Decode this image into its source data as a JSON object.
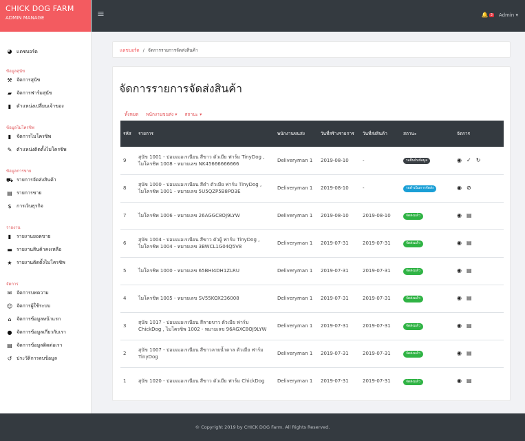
{
  "brand": {
    "title": "CHICK DOG FARM",
    "subtitle": "ADMIN MANAGE",
    "color": "#f35b60"
  },
  "topbar": {
    "menu_icon": "≡",
    "notif_icon": "bell-icon",
    "notif_count": "3",
    "user": "Admin ▾"
  },
  "sidebar": {
    "dashboard": {
      "icon": "dashboard-icon",
      "label": "แดชบอร์ด"
    },
    "sections": [
      {
        "title": "ข้อมูลสุนัข",
        "items": [
          {
            "icon": "hammer-icon",
            "label": "จัดการสุนัข"
          },
          {
            "icon": "garage-icon",
            "label": "จัดการฟาร์มสุนัข"
          },
          {
            "icon": "bookmark-icon",
            "label": "ตำแหน่งเปลี่ยนเจ้าของ"
          }
        ]
      },
      {
        "title": "ข้อมูลไมโครชิพ",
        "items": [
          {
            "icon": "chip-icon",
            "label": "จัดการไมโครชิพ"
          },
          {
            "icon": "pen-icon",
            "label": "ตำแหน่งติดตั้งไมโครชิพ"
          }
        ]
      },
      {
        "title": "ข้อมูลการขาย",
        "items": [
          {
            "icon": "truck-icon",
            "label": "รายการจัดส่งสินค้า"
          },
          {
            "icon": "file-icon",
            "label": "รายการขาย"
          },
          {
            "icon": "dollar-icon",
            "label": "การเงินธุรกิจ"
          }
        ]
      },
      {
        "title": "รายงาน",
        "items": [
          {
            "icon": "report-icon",
            "label": "รายงานยอดขาย"
          },
          {
            "icon": "storage-icon",
            "label": "รายงานสินค้าคงเหลือ"
          },
          {
            "icon": "star-icon",
            "label": "รายงานติดตั้งไมโครชิพ"
          }
        ]
      },
      {
        "title": "จัดการ",
        "items": [
          {
            "icon": "mail-icon",
            "label": "จัดการบทความ"
          },
          {
            "icon": "users-icon",
            "label": "จัดการผู้ใช้ระบบ"
          },
          {
            "icon": "home-icon",
            "label": "จัดการข้อมูลหน้าแรก"
          },
          {
            "icon": "info-icon",
            "label": "จัดการข้อมูลเกี่ยวกับเรา"
          },
          {
            "icon": "contact-icon",
            "label": "จัดการข้อมูลติดต่อเรา"
          },
          {
            "icon": "history-icon",
            "label": "ประวัติการลบข้อมูล"
          }
        ]
      }
    ]
  },
  "breadcrumb": {
    "home": "แดชบอร์ด",
    "separator": "/",
    "current": "จัดการรายการจัดส่งสินค้า"
  },
  "page": {
    "title": "จัดการรายการจัดส่งสินค้า",
    "filters": [
      "ทั้งหมด",
      "พนักงานขนส่ง ▾",
      "สถานะ ▾"
    ],
    "columns": [
      "รหัส",
      "รายการ",
      "พนักงานขนส่ง",
      "วันที่สร้างรายการ",
      "วันที่ส่งสินค้า",
      "สถานะ",
      "จัดการ"
    ],
    "rows": [
      {
        "id": "9",
        "item": "สุนัข 1001 - ปอมเมอเรเนียน สีขาว ตัวเมีย ฟาร์ม TinyDog , ไมโครชิพ 1008 - หมายเลข NK45666666666",
        "driver": "Deliveryman 1",
        "created": "2019-08-10",
        "shipped": "-",
        "status": "รอยืนยันข้อมูล",
        "status_color": "#3a3f44",
        "actions": [
          "eye-icon",
          "check-icon",
          "refresh-icon"
        ]
      },
      {
        "id": "8",
        "item": "สุนัข 1000 - ปอมเมอเรเนียน สีดำ ตัวเมีย ฟาร์ม TinyDog , ไมโครชิพ 1001 - หมายเลข 5U5QZP5B8PO3E",
        "driver": "Deliveryman 1",
        "created": "2019-08-10",
        "shipped": "-",
        "status": "รอดำเนินการจัดส่ง",
        "status_color": "#1a9fd6",
        "actions": [
          "eye-icon",
          "ban-icon"
        ]
      },
      {
        "id": "7",
        "item": "ไมโครชิพ 1006 - หมายเลข 26AGGC8OJ9LYW",
        "driver": "Deliveryman 1",
        "created": "2019-08-10",
        "shipped": "2019-08-10",
        "status": "จัดส่งแล้ว",
        "status_color": "#2fb344",
        "actions": [
          "eye-icon",
          "doc-icon"
        ]
      },
      {
        "id": "6",
        "item": "สุนัข 1004 - ปอมเมอเรเนียน สีขาว ตัวผู้ ฟาร์ม TinyDog , ไมโครชิพ 1004 - หมายเลข 3BWCL1G04Q5V8",
        "driver": "Deliveryman 1",
        "created": "2019-07-31",
        "shipped": "2019-07-31",
        "status": "จัดส่งแล้ว",
        "status_color": "#2fb344",
        "actions": [
          "eye-icon",
          "doc-icon"
        ]
      },
      {
        "id": "5",
        "item": "ไมโครชิพ 1000 - หมายเลข 65BHI4DH1ZLRU",
        "driver": "Deliveryman 1",
        "created": "2019-07-31",
        "shipped": "2019-07-31",
        "status": "จัดส่งแล้ว",
        "status_color": "#2fb344",
        "actions": [
          "eye-icon",
          "doc-icon"
        ]
      },
      {
        "id": "4",
        "item": "ไมโครชิพ 1005 - หมายเลข SV55KOX236008",
        "driver": "Deliveryman 1",
        "created": "2019-07-31",
        "shipped": "2019-07-31",
        "status": "จัดส่งแล้ว",
        "status_color": "#2fb344",
        "actions": [
          "eye-icon",
          "doc-icon"
        ]
      },
      {
        "id": "3",
        "item": "สุนัข 1017 - ปอมเมอเรเนียน สีลายขาว ตัวเมีย ฟาร์ม ChickDog , ไมโครชิพ 1002 - หมายเลข 96AGXC8OJ9LYW",
        "driver": "Deliveryman 1",
        "created": "2019-07-31",
        "shipped": "2019-07-31",
        "status": "จัดส่งแล้ว",
        "status_color": "#2fb344",
        "actions": [
          "eye-icon",
          "doc-icon"
        ]
      },
      {
        "id": "2",
        "item": "สุนัข 1007 - ปอมเมอเรเนียน สีขาวลายน้ำตาล ตัวเมีย ฟาร์ม TinyDog",
        "driver": "Deliveryman 1",
        "created": "2019-07-31",
        "shipped": "2019-07-31",
        "status": "จัดส่งแล้ว",
        "status_color": "#2fb344",
        "actions": [
          "eye-icon",
          "doc-icon"
        ]
      },
      {
        "id": "1",
        "item": "สุนัข 1020 - ปอมเมอเรเนียน สีขาว ตัวเมีย ฟาร์ม ChickDog",
        "driver": "Deliveryman 1",
        "created": "2019-07-31",
        "shipped": "2019-07-31",
        "status": "จัดส่งแล้ว",
        "status_color": "#2fb344",
        "actions": [
          "eye-icon",
          "doc-icon"
        ]
      }
    ]
  },
  "footer": {
    "text": "© Copyright 2019 by CHICK DOG Farm. All Rights Reserved."
  }
}
